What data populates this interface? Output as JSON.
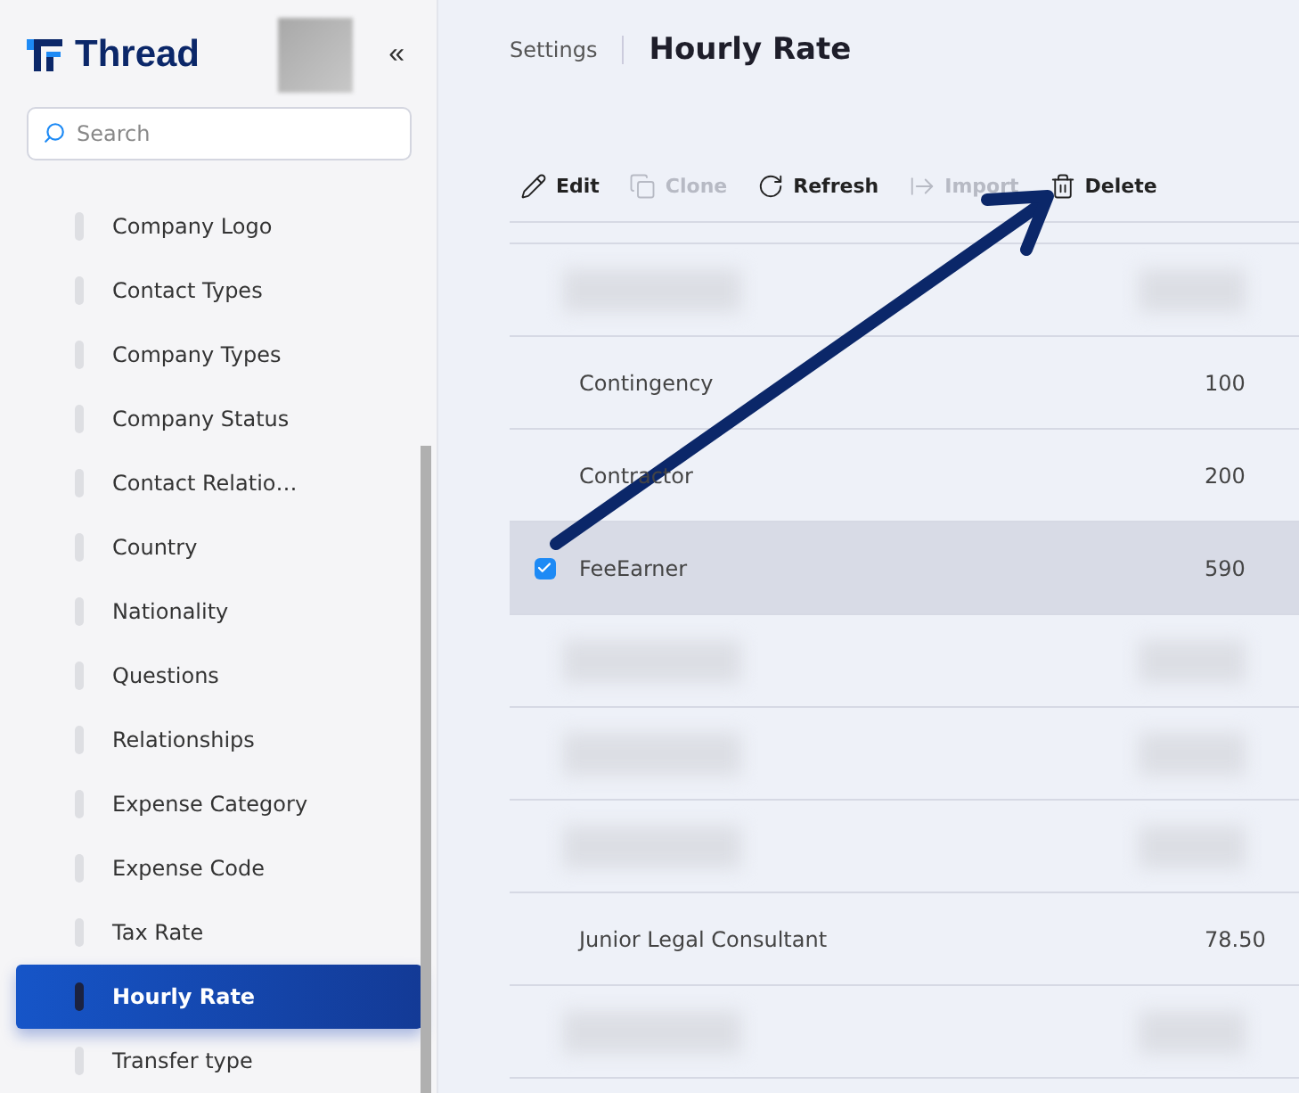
{
  "sidebar": {
    "logo": "Thread",
    "collapse_glyph": "«",
    "search": {
      "placeholder": "Search"
    },
    "items": [
      {
        "label": "Company Logo",
        "selected": false
      },
      {
        "label": "Contact Types",
        "selected": false
      },
      {
        "label": "Company Types",
        "selected": false
      },
      {
        "label": "Company Status",
        "selected": false
      },
      {
        "label": "Contact Relatio…",
        "selected": false
      },
      {
        "label": "Country",
        "selected": false
      },
      {
        "label": "Nationality",
        "selected": false
      },
      {
        "label": "Questions",
        "selected": false
      },
      {
        "label": "Relationships",
        "selected": false
      },
      {
        "label": "Expense Category",
        "selected": false
      },
      {
        "label": "Expense Code",
        "selected": false
      },
      {
        "label": "Tax Rate",
        "selected": false
      },
      {
        "label": "Hourly Rate",
        "selected": true
      },
      {
        "label": "Transfer type",
        "selected": false
      }
    ]
  },
  "breadcrumb": {
    "parent": "Settings",
    "title": "Hourly Rate"
  },
  "toolbar": [
    {
      "label": "Edit",
      "kind": "edit",
      "disabled": false
    },
    {
      "label": "Clone",
      "kind": "clone",
      "disabled": true
    },
    {
      "label": "Refresh",
      "kind": "refresh",
      "disabled": false
    },
    {
      "label": "Import",
      "kind": "import",
      "disabled": true
    },
    {
      "label": "Delete",
      "kind": "delete",
      "disabled": false
    }
  ],
  "table": {
    "rows": [
      {
        "kind": "redacted",
        "selected": false
      },
      {
        "kind": "data",
        "name": "Contingency",
        "rate": "100",
        "selected": false
      },
      {
        "kind": "data",
        "name": "Contractor",
        "rate": "200",
        "selected": false
      },
      {
        "kind": "data",
        "name": "FeeEarner",
        "rate": "590",
        "selected": true
      },
      {
        "kind": "redacted",
        "selected": false
      },
      {
        "kind": "redacted",
        "selected": false
      },
      {
        "kind": "redacted",
        "selected": false
      },
      {
        "kind": "data",
        "name": "Junior Legal Consultant",
        "rate": "78.50",
        "selected": false
      },
      {
        "kind": "redacted",
        "selected": false
      }
    ]
  }
}
